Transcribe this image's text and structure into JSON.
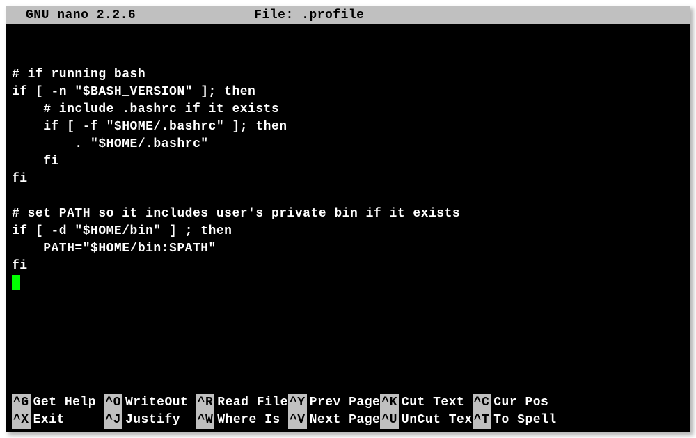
{
  "titlebar": {
    "app": "GNU nano 2.2.6",
    "file_label": "File:",
    "filename": ".profile"
  },
  "editor": {
    "lines": [
      "",
      "# if running bash",
      "if [ -n \"$BASH_VERSION\" ]; then",
      "    # include .bashrc if it exists",
      "    if [ -f \"$HOME/.bashrc\" ]; then",
      "        . \"$HOME/.bashrc\"",
      "    fi",
      "fi",
      "",
      "# set PATH so it includes user's private bin if it exists",
      "if [ -d \"$HOME/bin\" ] ; then",
      "    PATH=\"$HOME/bin:$PATH\"",
      "fi"
    ]
  },
  "shortcuts": {
    "row1": [
      {
        "key": "^G",
        "label": "Get Help "
      },
      {
        "key": "^O",
        "label": "WriteOut "
      },
      {
        "key": "^R",
        "label": "Read File"
      },
      {
        "key": "^Y",
        "label": "Prev Page"
      },
      {
        "key": "^K",
        "label": "Cut Text "
      },
      {
        "key": "^C",
        "label": "Cur Pos"
      }
    ],
    "row2": [
      {
        "key": "^X",
        "label": "Exit     "
      },
      {
        "key": "^J",
        "label": "Justify  "
      },
      {
        "key": "^W",
        "label": "Where Is "
      },
      {
        "key": "^V",
        "label": "Next Page"
      },
      {
        "key": "^U",
        "label": "UnCut Tex"
      },
      {
        "key": "^T",
        "label": "To Spell"
      }
    ]
  }
}
